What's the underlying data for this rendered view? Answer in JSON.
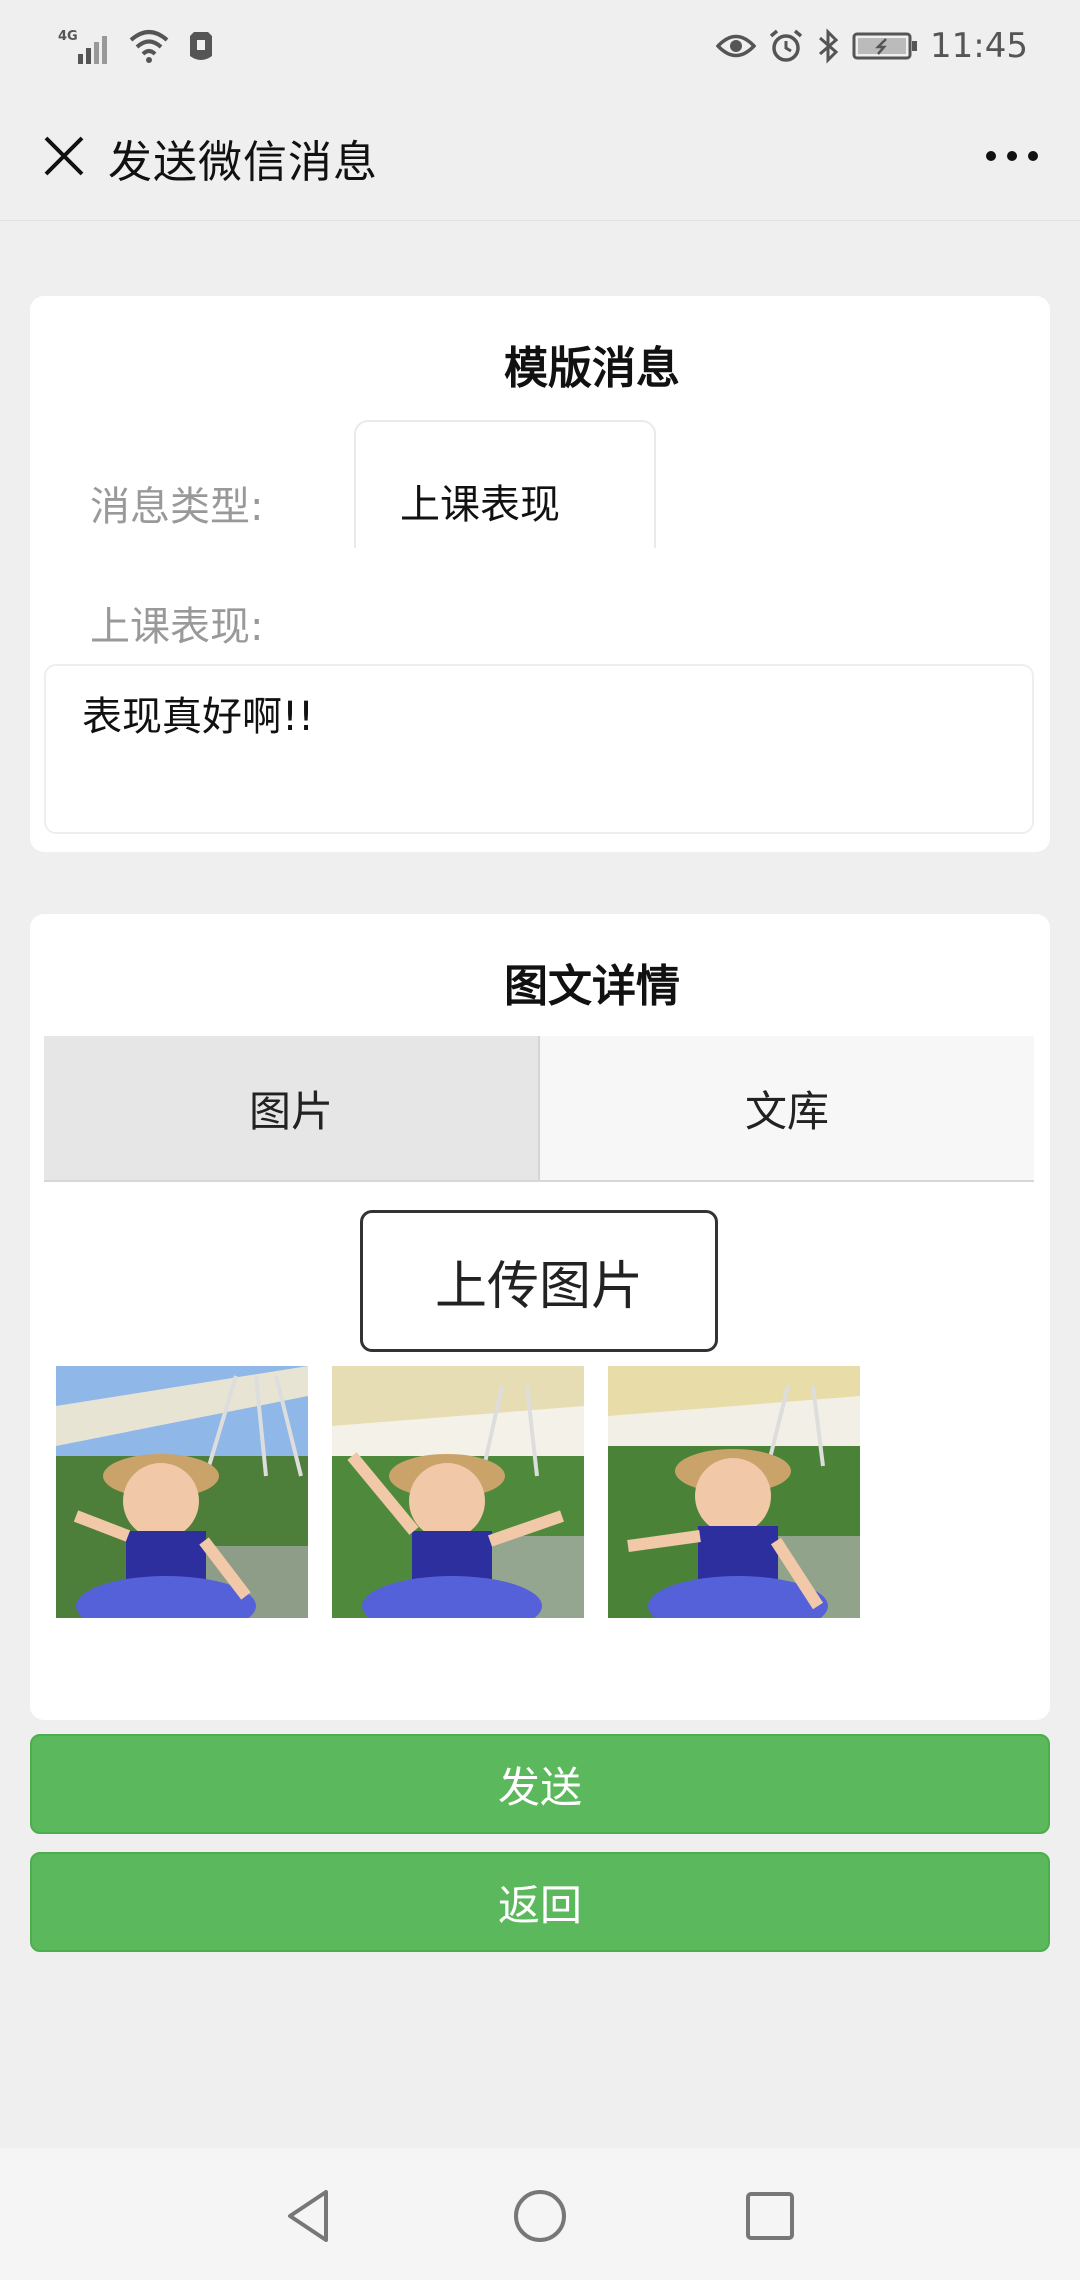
{
  "status_bar": {
    "network": "4G",
    "time": "11:45",
    "icons": [
      "signal-icon",
      "wifi-icon",
      "notification-icon",
      "eye-icon",
      "alarm-icon",
      "bluetooth-icon",
      "battery-icon"
    ]
  },
  "nav": {
    "title": "发送微信消息",
    "close_icon": "close-icon",
    "more_icon": "more-icon"
  },
  "template_card": {
    "title": "模版消息",
    "message_type_label": "消息类型:",
    "message_type_value": "上课表现",
    "performance_label": "上课表现:",
    "performance_text": "表现真好啊!!"
  },
  "detail_card": {
    "title": "图文详情",
    "tabs": [
      {
        "label": "图片",
        "active": true
      },
      {
        "label": "文库",
        "active": false
      }
    ],
    "upload_label": "上传图片",
    "images": [
      "photo-1",
      "photo-2",
      "photo-3"
    ]
  },
  "actions": {
    "send_label": "发送",
    "back_label": "返回"
  },
  "colors": {
    "button_green": "#5cb85c",
    "page_bg": "#efefef",
    "card_bg": "#ffffff"
  }
}
